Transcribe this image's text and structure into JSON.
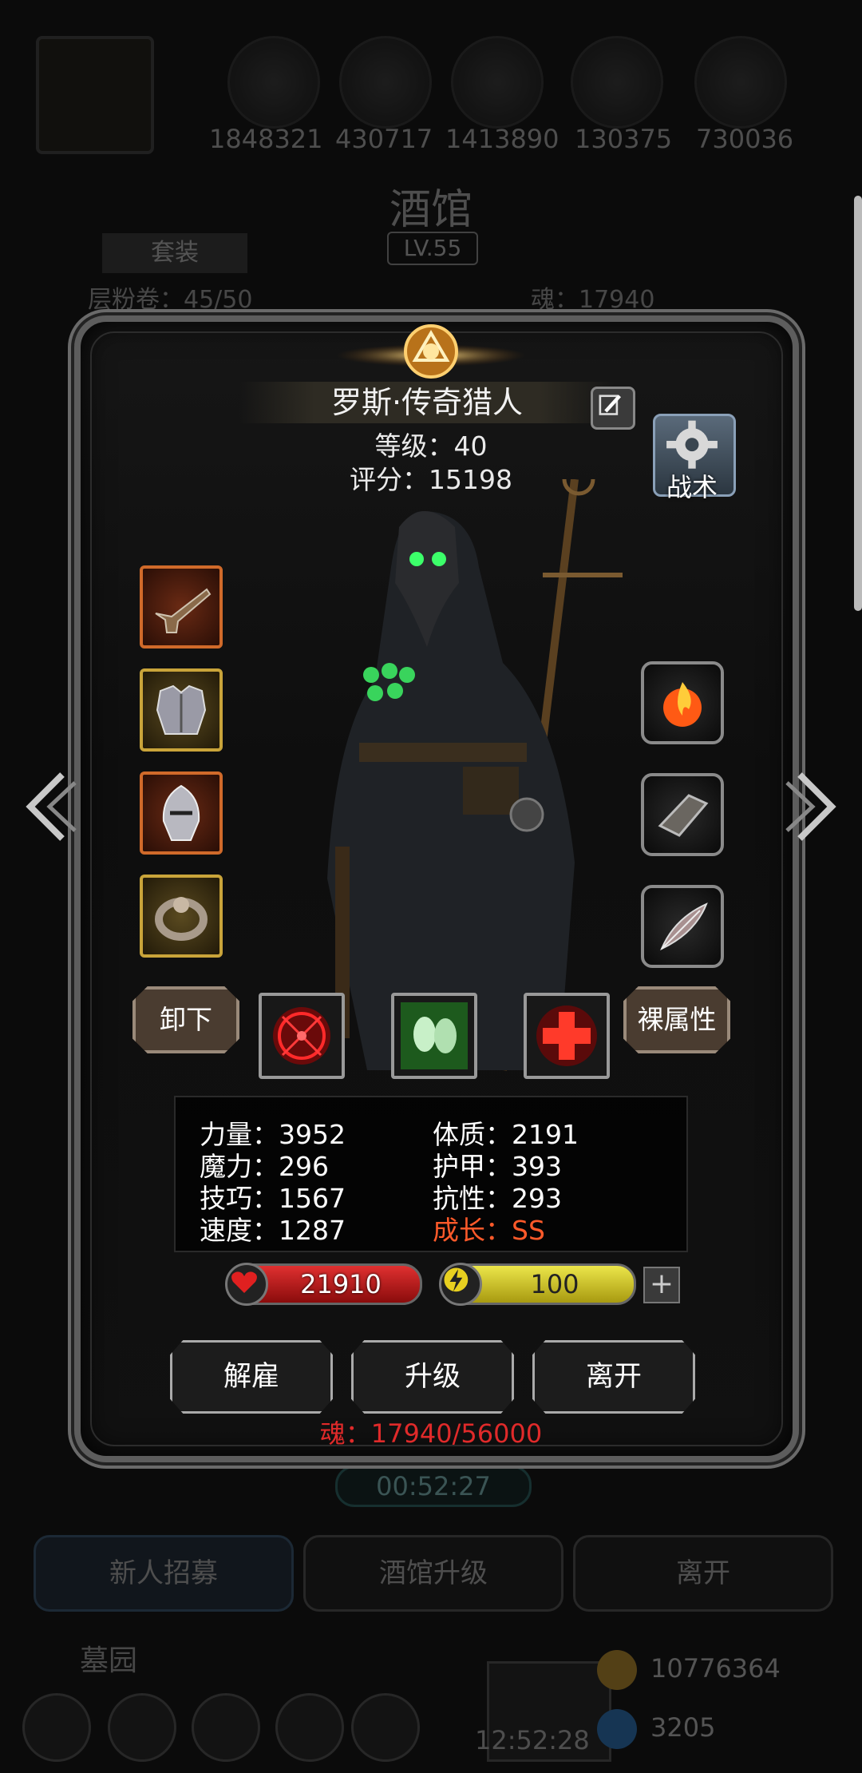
{
  "background": {
    "resources": [
      "1848321",
      "430717",
      "1413890",
      "130375",
      "730036"
    ],
    "title": "酒馆",
    "level": "LV.55",
    "suit_button": "套装",
    "side_left": "层粉卷：45/50",
    "side_right": "魂：17940",
    "timer": "00:52:27",
    "buttons": [
      "新人招募",
      "酒馆升级",
      "离开"
    ],
    "graveyard": "墓园",
    "gift_timer": "12:52:28",
    "gold": "10776364",
    "gems": "3205"
  },
  "hero": {
    "name": "罗斯·传奇猎人",
    "level_text": "等级：40",
    "score_text": "评分：15198"
  },
  "tactics_label": "战术",
  "left_equipment": [
    "pistol",
    "chest-armor",
    "helmet",
    "ring"
  ],
  "right_equipment": [
    "fire-orb",
    "bracer",
    "feather"
  ],
  "unequip_label": "卸下",
  "base_attr_label": "裸属性",
  "skills": [
    "target-skill",
    "ghost-skill",
    "heal-skill"
  ],
  "attributes": {
    "strength": "力量：3952",
    "magic": "魔力：296",
    "skill": "技巧：1567",
    "speed": "速度：1287",
    "constitution": "体质：2191",
    "armor": "护甲：393",
    "resistance": "抗性：293",
    "growth": "成长：SS"
  },
  "bars": {
    "hp": "21910",
    "energy": "100",
    "plus": "+"
  },
  "actions": {
    "dismiss": "解雇",
    "upgrade": "升级",
    "leave": "离开"
  },
  "soul_text": "魂：17940/56000",
  "colors": {
    "growth": "#ff5a2a",
    "soul": "#e02a2a",
    "hp_bar": "#d02424",
    "energy_bar": "#e0d830"
  }
}
